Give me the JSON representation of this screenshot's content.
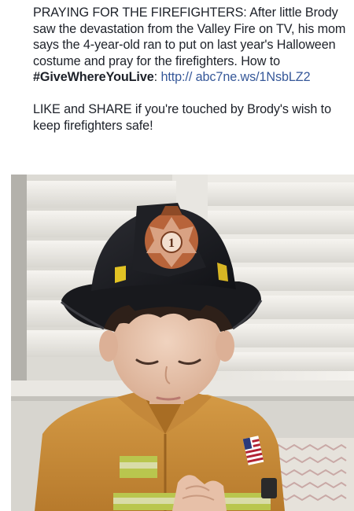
{
  "post": {
    "caption_lead": "PRAYING FOR THE FIREFIGHTERS: After little Brody saw the devastation from the Valley Fire on TV, his mom says the 4-year-old ran to put on last year's Halloween costume and pray for the firefighters. How to ",
    "hashtag": "#GiveWhereYouLive",
    "hashtag_suffix": ": ",
    "link": "http:// abc7ne.ws/1NsbLZ2",
    "call_to_action": "LIKE and SHARE if you're touched by Brody's wish to keep firefighters safe!"
  },
  "photo": {
    "helmet_badge_number": "1"
  },
  "colors": {
    "text": "#1d2129",
    "link": "#365899",
    "helmet": "#1b1c20",
    "badge": "#b8643a",
    "coat": "#c98a38",
    "reflective_stripe": "#b9c64e"
  },
  "icons": {
    "helmet_badge": "maltese-cross-badge-icon",
    "flag": "us-flag-patch-icon"
  }
}
